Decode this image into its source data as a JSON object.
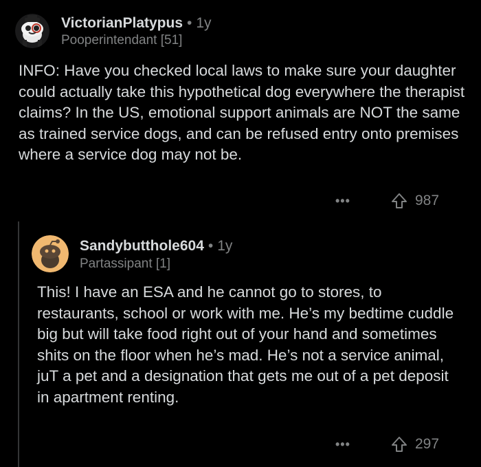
{
  "comments": [
    {
      "author": "VictorianPlatypus",
      "separator": "•",
      "age": "1y",
      "flair": "Pooperintendant [51]",
      "body": "INFO: Have you checked local laws to make sure your daughter could actually take this hypothetical dog everywhere the therapist claims? In the US, emotional support animals are NOT the same as trained service dogs, and can be refused entry onto premises where a service dog may not be.",
      "more": "•••",
      "score": "987"
    },
    {
      "author": "Sandybutthole604",
      "separator": "•",
      "age": "1y",
      "flair": "Partassipant [1]",
      "body": "This! I have an ESA and he cannot go to stores, to restaurants, school or work with me. He’s my bedtime cuddle big but will take food right out of your hand and sometimes shits on the floor when he’s mad. He’s not a service animal, juT a pet and a designation that gets me out of a pet deposit in apartment renting.",
      "more": "•••",
      "score": "297"
    }
  ],
  "colors": {
    "background": "#000000",
    "text": "#d7dadc",
    "muted": "#818384",
    "thread_line": "#343536"
  },
  "icons": {
    "avatar_1": "snoo-avatar-icon",
    "avatar_2": "snoo-avatar-icon",
    "upvote": "upvote-arrow-icon",
    "more": "more-options-icon"
  }
}
